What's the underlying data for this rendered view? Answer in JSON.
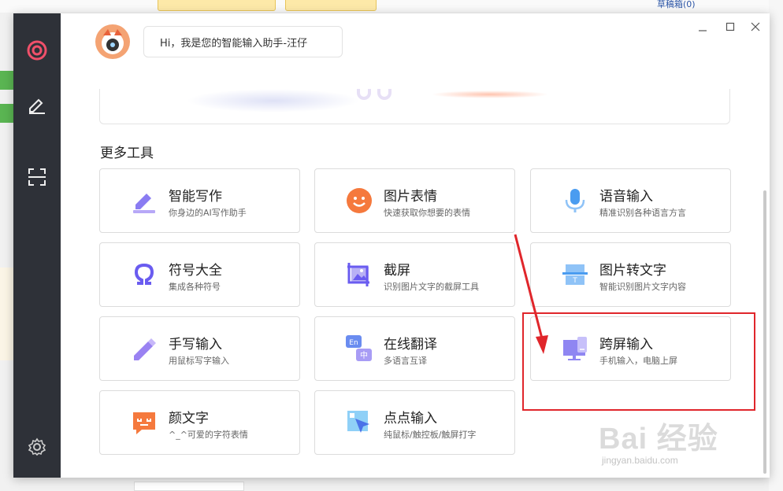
{
  "background": {
    "drafts_label": "草稿箱(0)"
  },
  "dialog": {
    "window_controls": [
      "minimize-icon",
      "maximize-icon",
      "close-icon"
    ],
    "sidebar_icons": [
      "logo-icon",
      "writing-icon",
      "screenshot-icon",
      "settings-icon"
    ],
    "greeting": "Hi，我是您的智能输入助手-汪仔",
    "section_title": "更多工具",
    "tools": [
      {
        "name": "智能写作",
        "desc": "你身边的AI写作助手",
        "icon": "pen-icon",
        "color": "#7b6cf0"
      },
      {
        "name": "图片表情",
        "desc": "快速获取你想要的表情",
        "icon": "smiley-icon",
        "color": "#f0783c"
      },
      {
        "name": "语音输入",
        "desc": "精准识别各种语言方言",
        "icon": "microphone-icon",
        "color": "#4a9cf0"
      },
      {
        "name": "符号大全",
        "desc": "集成各种符号",
        "icon": "omega-icon",
        "color": "#6a5cf0"
      },
      {
        "name": "截屏",
        "desc": "识别图片文字的截屏工具",
        "icon": "crop-icon",
        "color": "#6a5cf0"
      },
      {
        "name": "图片转文字",
        "desc": "智能识别图片文字内容",
        "icon": "image-text-icon",
        "color": "#4a9cf0"
      },
      {
        "name": "手写输入",
        "desc": "用鼠标写字输入",
        "icon": "handwrite-icon",
        "color": "#8a6cf0"
      },
      {
        "name": "在线翻译",
        "desc": "多语言互译",
        "icon": "translate-icon",
        "color": "#6a8cf0"
      },
      {
        "name": "跨屏输入",
        "desc": "手机输入，电脑上屏",
        "icon": "cross-screen-icon",
        "color": "#7a6cf0"
      },
      {
        "name": "颜文字",
        "desc": "^_^可爱的字符表情",
        "icon": "kaomoji-icon",
        "color": "#f07838"
      },
      {
        "name": "点点输入",
        "desc": "纯鼠标/触控板/触屏打字",
        "icon": "cursor-icon",
        "color": "#4aa0f0"
      }
    ]
  },
  "annotation": {
    "arrow_color": "#e0262b"
  },
  "watermark": {
    "big": "Bai 经验",
    "small": "jingyan.baidu.com"
  }
}
